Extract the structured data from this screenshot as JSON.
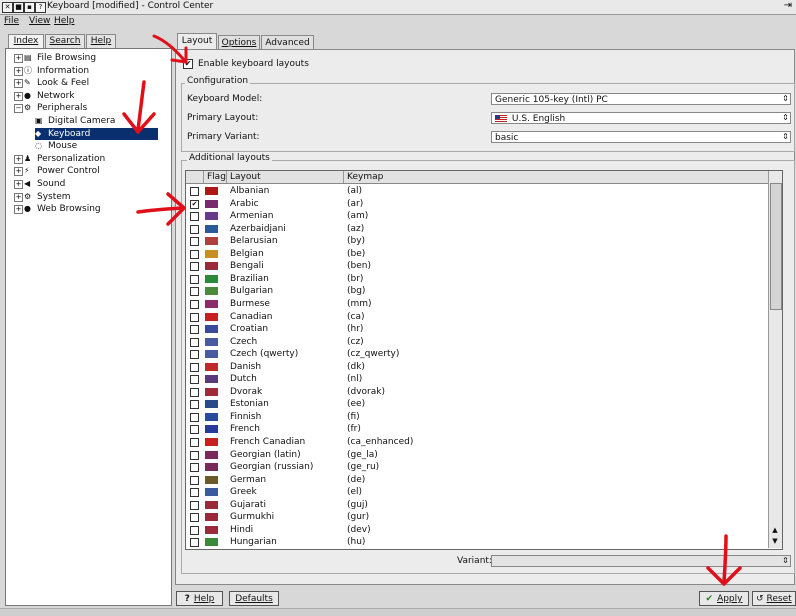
{
  "window": {
    "title": "Keyboard [modified] - Control Center",
    "buttons": [
      "✕",
      "■",
      "▪",
      "?"
    ],
    "right_icon": "⇥"
  },
  "menubar": [
    "File",
    "View",
    "Help"
  ],
  "left_tabs": [
    "Index",
    "Search",
    "Help"
  ],
  "tree": [
    {
      "label": "File Browsing",
      "icon": "folder-icon",
      "level": 0,
      "expander": "+"
    },
    {
      "label": "Information",
      "icon": "info-icon",
      "level": 0,
      "expander": "+"
    },
    {
      "label": "Look & Feel",
      "icon": "palette-icon",
      "level": 0,
      "expander": "+"
    },
    {
      "label": "Network",
      "icon": "globe-icon",
      "level": 0,
      "expander": "+"
    },
    {
      "label": "Peripherals",
      "icon": "plug-icon",
      "level": 0,
      "expander": "−"
    },
    {
      "label": "Digital Camera",
      "icon": "camera-icon",
      "level": 1
    },
    {
      "label": "Keyboard",
      "icon": "keyboard-icon",
      "level": 1,
      "selected": true
    },
    {
      "label": "Mouse",
      "icon": "mouse-icon",
      "level": 1
    },
    {
      "label": "Personalization",
      "icon": "person-icon",
      "level": 0,
      "expander": "+"
    },
    {
      "label": "Power Control",
      "icon": "power-icon",
      "level": 0,
      "expander": "+"
    },
    {
      "label": "Sound",
      "icon": "speaker-icon",
      "level": 0,
      "expander": "+"
    },
    {
      "label": "System",
      "icon": "system-icon",
      "level": 0,
      "expander": "+"
    },
    {
      "label": "Web Browsing",
      "icon": "globe-icon",
      "level": 0,
      "expander": "+"
    }
  ],
  "right_tabs": [
    "Layout",
    "Options",
    "Advanced"
  ],
  "enable_label": "Enable keyboard layouts",
  "enable_checked": true,
  "configuration": {
    "title": "Configuration",
    "keyboard_model_label": "Keyboard Model:",
    "keyboard_model_value": "Generic 105-key (Intl) PC",
    "primary_layout_label": "Primary Layout:",
    "primary_layout_value": "U.S. English",
    "primary_variant_label": "Primary Variant:",
    "primary_variant_value": "basic"
  },
  "additional_layouts": {
    "title": "Additional layouts",
    "columns": [
      "Flag",
      "Layout",
      "Keymap"
    ],
    "rows": [
      {
        "layout": "Albanian",
        "keymap": "(al)",
        "checked": false,
        "flag": "#b01818"
      },
      {
        "layout": "Arabic",
        "keymap": "(ar)",
        "checked": true,
        "flag": "#7a2a6a"
      },
      {
        "layout": "Armenian",
        "keymap": "(am)",
        "checked": false,
        "flag": "#6a3a8a"
      },
      {
        "layout": "Azerbaidjani",
        "keymap": "(az)",
        "checked": false,
        "flag": "#2a5a9a"
      },
      {
        "layout": "Belarusian",
        "keymap": "(by)",
        "checked": false,
        "flag": "#b04040"
      },
      {
        "layout": "Belgian",
        "keymap": "(be)",
        "checked": false,
        "flag": "#c89020"
      },
      {
        "layout": "Bengali",
        "keymap": "(ben)",
        "checked": false,
        "flag": "#9a2a3a"
      },
      {
        "layout": "Brazilian",
        "keymap": "(br)",
        "checked": false,
        "flag": "#2a8a3a"
      },
      {
        "layout": "Bulgarian",
        "keymap": "(bg)",
        "checked": false,
        "flag": "#4a8a3a"
      },
      {
        "layout": "Burmese",
        "keymap": "(mm)",
        "checked": false,
        "flag": "#8a2a6a"
      },
      {
        "layout": "Canadian",
        "keymap": "(ca)",
        "checked": false,
        "flag": "#c82020"
      },
      {
        "layout": "Croatian",
        "keymap": "(hr)",
        "checked": false,
        "flag": "#3a4a9a"
      },
      {
        "layout": "Czech",
        "keymap": "(cz)",
        "checked": false,
        "flag": "#4a5aa0"
      },
      {
        "layout": "Czech (qwerty)",
        "keymap": "(cz_qwerty)",
        "checked": false,
        "flag": "#4a5aa0"
      },
      {
        "layout": "Danish",
        "keymap": "(dk)",
        "checked": false,
        "flag": "#c02a2a"
      },
      {
        "layout": "Dutch",
        "keymap": "(nl)",
        "checked": false,
        "flag": "#5a3a7a"
      },
      {
        "layout": "Dvorak",
        "keymap": "(dvorak)",
        "checked": false,
        "flag": "#a02a3a"
      },
      {
        "layout": "Estonian",
        "keymap": "(ee)",
        "checked": false,
        "flag": "#2a4a8a"
      },
      {
        "layout": "Finnish",
        "keymap": "(fi)",
        "checked": false,
        "flag": "#2a4aa0"
      },
      {
        "layout": "French",
        "keymap": "(fr)",
        "checked": false,
        "flag": "#2a3a9a"
      },
      {
        "layout": "French Canadian",
        "keymap": "(ca_enhanced)",
        "checked": false,
        "flag": "#c82020"
      },
      {
        "layout": "Georgian (latin)",
        "keymap": "(ge_la)",
        "checked": false,
        "flag": "#7a2a5a"
      },
      {
        "layout": "Georgian (russian)",
        "keymap": "(ge_ru)",
        "checked": false,
        "flag": "#7a2a5a"
      },
      {
        "layout": "German",
        "keymap": "(de)",
        "checked": false,
        "flag": "#6a5a2a"
      },
      {
        "layout": "Greek",
        "keymap": "(el)",
        "checked": false,
        "flag": "#3a5aa0"
      },
      {
        "layout": "Gujarati",
        "keymap": "(guj)",
        "checked": false,
        "flag": "#9a2a3a"
      },
      {
        "layout": "Gurmukhi",
        "keymap": "(gur)",
        "checked": false,
        "flag": "#9a2a3a"
      },
      {
        "layout": "Hindi",
        "keymap": "(dev)",
        "checked": false,
        "flag": "#9a2a3a"
      },
      {
        "layout": "Hungarian",
        "keymap": "(hu)",
        "checked": false,
        "flag": "#3a8a3a"
      }
    ]
  },
  "variant_label": "Variant:",
  "variant_value": "",
  "bottom_buttons": {
    "help": "Help",
    "defaults": "Defaults",
    "apply": "Apply",
    "reset": "Reset"
  },
  "colors": {
    "selection": "#0a2f6e",
    "annotation": "#e0101a"
  }
}
